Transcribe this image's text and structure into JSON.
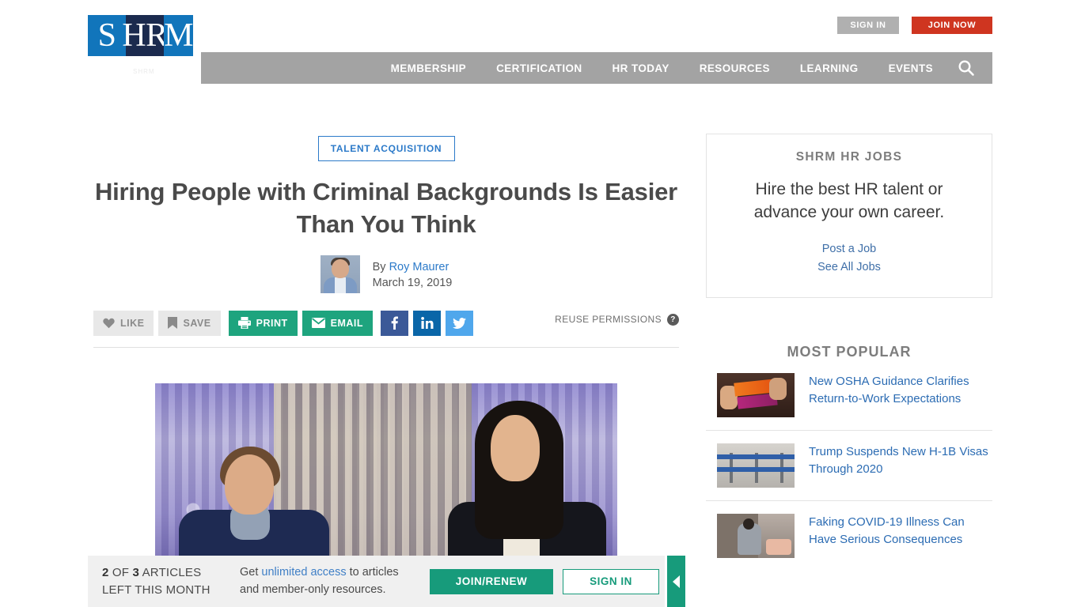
{
  "header": {
    "logo": {
      "part1": "S",
      "part2": "HR",
      "part3": "M",
      "sub": "SHRM"
    },
    "signin_top": "SIGN IN",
    "joinnow_top": "JOIN NOW",
    "nav": [
      {
        "label": "MEMBERSHIP"
      },
      {
        "label": "CERTIFICATION"
      },
      {
        "label": "HR TODAY"
      },
      {
        "label": "RESOURCES"
      },
      {
        "label": "LEARNING"
      },
      {
        "label": "EVENTS"
      }
    ],
    "search_icon": "search-icon"
  },
  "article": {
    "category": "TALENT ACQUISITION",
    "title": "Hiring People with Criminal Backgrounds Is Easier Than You Think",
    "by_prefix": "By ",
    "author": "Roy Maurer",
    "date": "March 19, 2019",
    "actions": {
      "like": "LIKE",
      "save": "SAVE",
      "print": "PRINT",
      "email": "EMAIL",
      "facebook": "facebook-icon",
      "linkedin": "linkedin-icon",
      "twitter": "twitter-icon"
    },
    "reuse_permissions": "REUSE PERMISSIONS"
  },
  "sidebar": {
    "jobs": {
      "title": "SHRM HR JOBS",
      "copy": "Hire the best HR talent or advance your own career.",
      "link_post": "Post a Job",
      "link_all": "See All Jobs"
    },
    "most_popular": {
      "title": "MOST POPULAR",
      "items": [
        {
          "title": "New OSHA Guidance Clarifies Return-to-Work Expectations"
        },
        {
          "title": "Trump Suspends New H-1B Visas Through 2020"
        },
        {
          "title": "Faking COVID-19 Illness Can Have Serious Consequences"
        }
      ]
    }
  },
  "paywall": {
    "count_line1_num1": "2",
    "count_line1_mid": " OF ",
    "count_line1_num2": "3",
    "count_line1_end": " ARTICLES",
    "count_line2": "LEFT THIS MONTH",
    "copy_pre": "Get ",
    "copy_link": "unlimited access",
    "copy_post": " to articles and member-only resources.",
    "join": "JOIN/RENEW",
    "signin": "SIGN IN",
    "toggle_icon": "chevron-left-icon"
  },
  "colors": {
    "brand_blue": "#1175bb",
    "brand_navy": "#1b2a4e",
    "join_red": "#cf3520",
    "green": "#1ea47e",
    "paywall_green": "#179b7b",
    "link_blue": "#2c6cb3",
    "nav_gray": "#a3a3a3"
  }
}
